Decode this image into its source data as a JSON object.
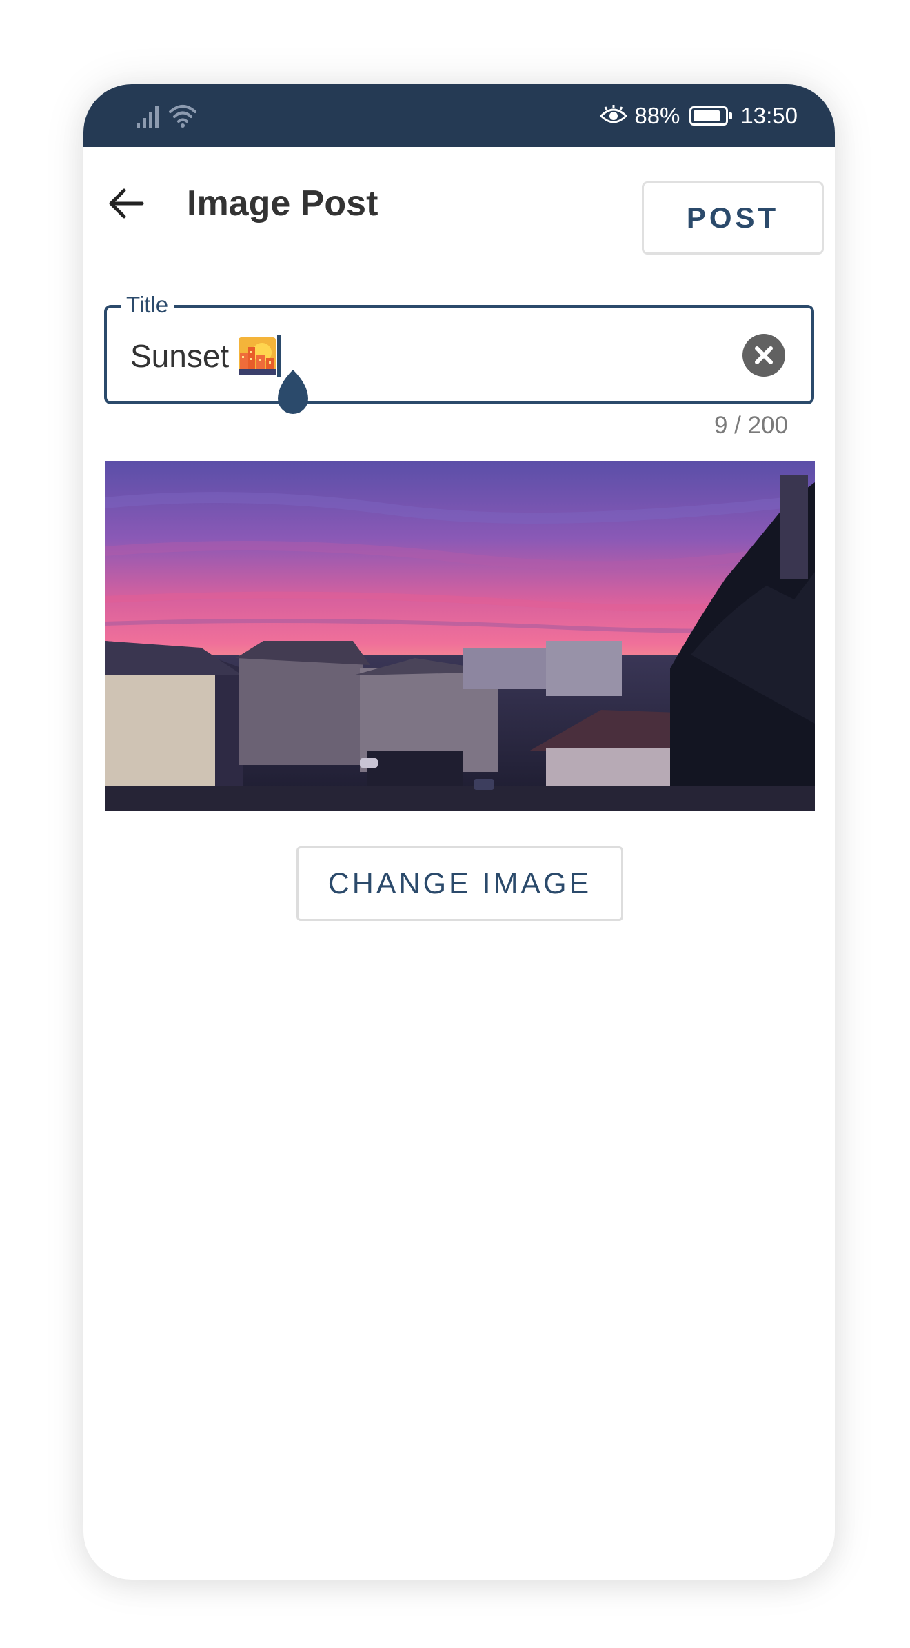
{
  "status_bar": {
    "battery_percent": "88%",
    "battery_level": 0.88,
    "time": "13:50",
    "icons": [
      "signal-icon",
      "wifi-icon",
      "eye-comfort-icon",
      "battery-icon"
    ]
  },
  "app_bar": {
    "title": "Image Post",
    "back_icon": "arrow-left-icon",
    "post_label": "POST"
  },
  "title_field": {
    "label": "Title",
    "value": "Sunset",
    "emoji": "sunset-city-emoji",
    "clear_icon": "close-circle-icon",
    "counter": "9 / 200"
  },
  "image": {
    "description_icon": "sunset-photo"
  },
  "change_image_label": "CHANGE IMAGE",
  "colors": {
    "status_bar": "#253a54",
    "accent": "#2b4a6b",
    "text": "#333333",
    "counter": "#7a7a7a",
    "clear_button": "#616161"
  }
}
